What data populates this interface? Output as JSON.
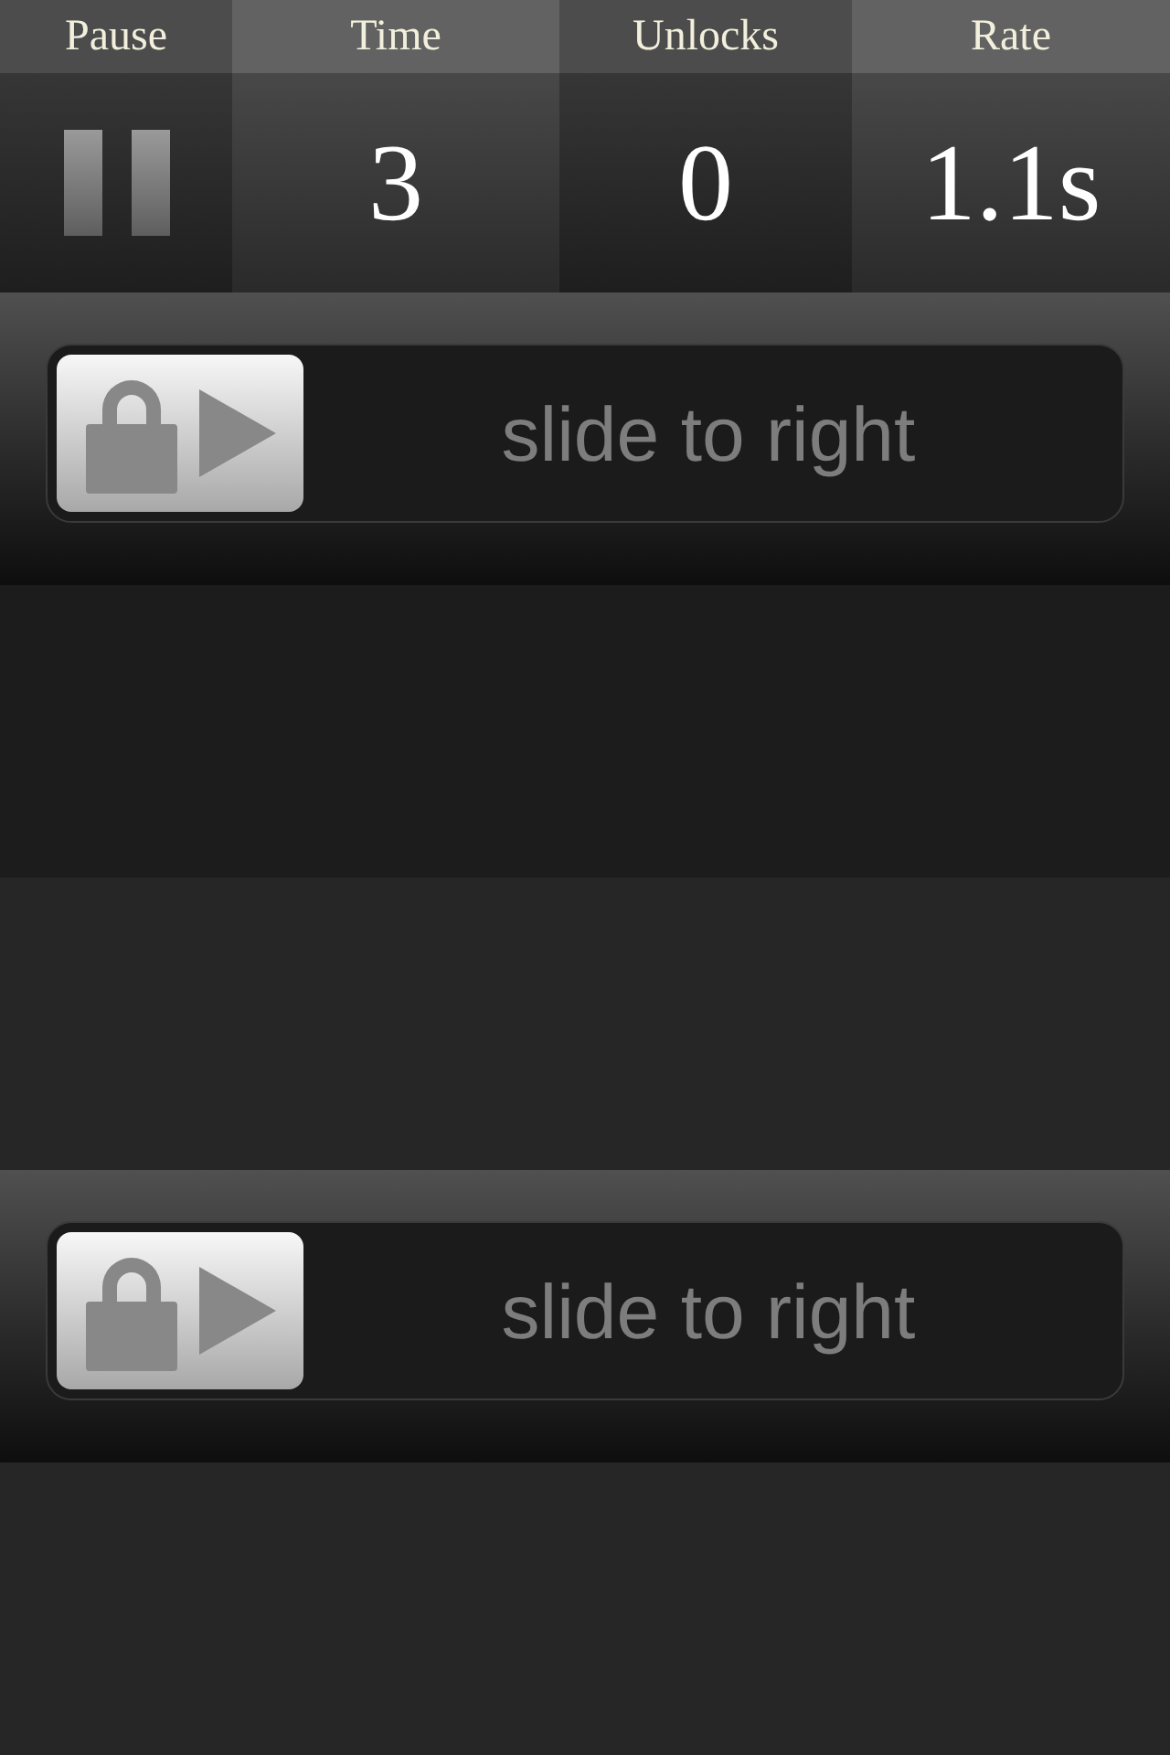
{
  "stats": [
    {
      "label": "Pause",
      "kind": "pause"
    },
    {
      "label": "Time",
      "kind": "value",
      "value": "3"
    },
    {
      "label": "Unlocks",
      "kind": "value",
      "value": "0"
    },
    {
      "label": "Rate",
      "kind": "value",
      "value": "1.1s"
    }
  ],
  "rows": [
    {
      "kind": "slider",
      "text": "slide to right"
    },
    {
      "kind": "empty"
    },
    {
      "kind": "empty"
    },
    {
      "kind": "slider",
      "text": "slide to right"
    },
    {
      "kind": "empty"
    }
  ]
}
